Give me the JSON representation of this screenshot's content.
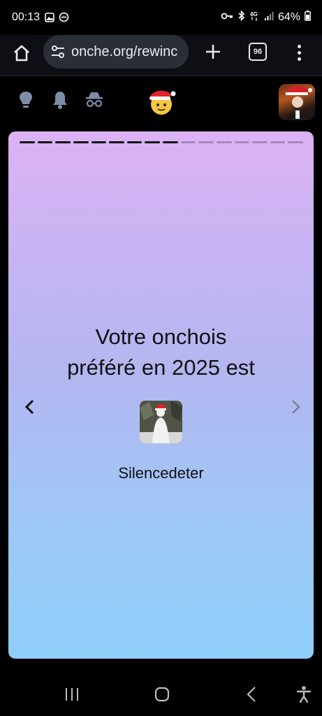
{
  "status_bar": {
    "time": "00:13",
    "battery": "64%",
    "icons": [
      "image-icon",
      "dnd-icon",
      "vpn-key-icon",
      "bluetooth-icon",
      "4g-icon",
      "signal-icon",
      "battery-icon"
    ]
  },
  "browser": {
    "url": "onche.org/rewinc",
    "tab_count": "96",
    "icons": [
      "home-icon",
      "site-settings-icon",
      "new-tab-icon",
      "tab-switcher-icon",
      "more-menu-icon"
    ]
  },
  "site_header": {
    "icons": [
      "lightbulb-icon",
      "bell-icon",
      "incognito-icon",
      "onche-logo",
      "user-avatar"
    ]
  },
  "story": {
    "progress_total": 16,
    "progress_done": 9,
    "title_line1": "Votre onchois",
    "title_line2": "préféré en 2025 est",
    "username": "Silencedeter"
  },
  "colors": {
    "card_top": "#dcb2f5",
    "card_bottom": "#8fcefa",
    "toolbar_bg": "#0d0f14",
    "urlbar_bg": "#2a2f37"
  }
}
